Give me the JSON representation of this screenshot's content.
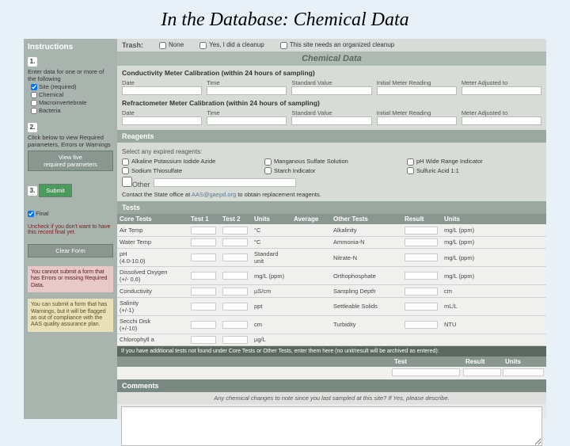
{
  "title": "In the Database: Chemical Data",
  "sidebar": {
    "heading": "Instructions",
    "step1": "Enter data for one or more of the following",
    "req1": "Site (required)",
    "req2": "Chemical",
    "req3": "Macroinvertebrate",
    "req4": "Bacteria",
    "step2": "Click below to view Required parameters, Errors or Warnings",
    "view_btn_l1": "View five",
    "view_btn_l2": "required parameters",
    "submit": "Submit",
    "final": "Final",
    "final_warn": "Uncheck if you don't want to have this record final yet.",
    "clear": "Clear Form",
    "redbox": "You cannot submit a form that has Errors or missing Required Data.",
    "yellowbox": "You can submit a form that has Warnings, but it will be flagged as out of compliance with the AAS quality assurance plan."
  },
  "trash": {
    "label": "Trash:",
    "opt1": "None",
    "opt2": "Yes, I did a cleanup",
    "opt3": "This site needs an organized cleanup"
  },
  "chem_heading": "Chemical Data",
  "calib1": {
    "title": "Conductivity Meter Calibration (within 24 hours of sampling)",
    "c1": "Date",
    "c2": "Time",
    "c3": "Standard Value",
    "c4": "Initial Meter Reading",
    "c5": "Meter Adjusted to"
  },
  "calib2": {
    "title": "Refractometer Meter Calibration (within 24 hours of sampling)",
    "c1": "Date",
    "c2": "Time",
    "c3": "Standard Value",
    "c4": "Initial Meter Reading",
    "c5": "Meter Adjusted to"
  },
  "reagents": {
    "heading": "Reagents",
    "note": "Select any expired reagents:",
    "r1": "Alkaline Potassium Iodide Azide",
    "r2": "Manganous Sulfate Solution",
    "r3": "pH Wide Range Indicator",
    "r4": "Sodium Thiosulfate",
    "r5": "Starch Indicator",
    "r6": "Sulfuric Acid 1:1",
    "other": "Other",
    "contact_pre": "Contact the State office at ",
    "contact_email": "AAS@gaepd.org",
    "contact_post": " to obtain replacement reagents."
  },
  "tests": {
    "heading": "Tests",
    "h_core": "Core Tests",
    "h_t1": "Test 1",
    "h_t2": "Test 2",
    "h_units": "Units",
    "h_avg": "Average",
    "h_other": "Other Tests",
    "h_res": "Result",
    "h_units2": "Units",
    "rows": [
      {
        "core": "Air Temp",
        "unit": "°C",
        "other": "Alkalinity",
        "unit2": "mg/L (ppm)"
      },
      {
        "core": "Water Temp",
        "unit": "°C",
        "other": "Ammonia-N",
        "unit2": "mg/L (ppm)"
      },
      {
        "core": "pH\n(4.0-10.0)",
        "unit": "Standard unit",
        "other": "Nitrate-N",
        "unit2": "mg/L (ppm)"
      },
      {
        "core": "Dissolved Oxygen\n(+/- 0.6)",
        "unit": "mg/L (ppm)",
        "other": "Orthophosphate",
        "unit2": "mg/L (ppm)"
      },
      {
        "core": "Conductivity",
        "unit": "µS/cm",
        "other": "Sampling Depth",
        "unit2": "cm"
      },
      {
        "core": "Salinity\n(+/-1)",
        "unit": "ppt",
        "other": "Settleable Solids",
        "unit2": "mL/L"
      },
      {
        "core": "Secchi Disk\n(+/-10)",
        "unit": "cm",
        "other": "Turbidity",
        "unit2": "NTU"
      },
      {
        "core": "Chlorophyll a",
        "unit": "µg/L",
        "other": "",
        "unit2": ""
      }
    ],
    "hint": "If you have additional tests not found under Core Tests or Other Tests, enter them here (no unit/result will be archived as entered):",
    "extra_h_test": "Test",
    "extra_h_res": "Result",
    "extra_h_unit": "Units"
  },
  "comments": {
    "heading": "Comments",
    "note": "Any chemical changes to note since you last sampled at this site? If Yes, please describe."
  }
}
